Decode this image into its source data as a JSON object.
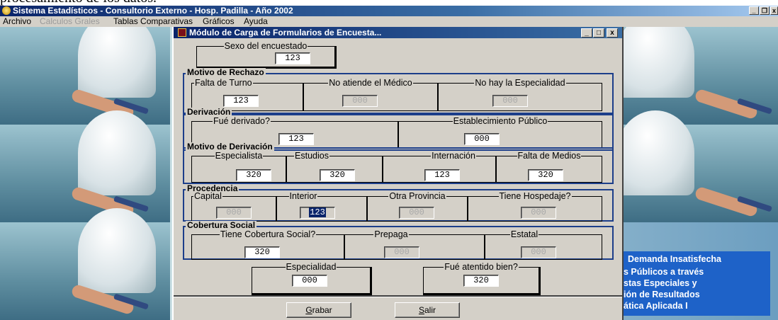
{
  "overtext": "procesamiento de los datos.",
  "app": {
    "title": "Sistema Estadísticos - Consultorio Externo - Hosp. Padilla - Año 2002",
    "win_buttons": [
      "_",
      "❐",
      "x"
    ]
  },
  "menu": {
    "items": [
      {
        "label": "Archivo",
        "disabled": false
      },
      {
        "label": "Calculos Grales",
        "disabled": true
      },
      {
        "label": "Tablas Comparativas",
        "disabled": false
      },
      {
        "label": "Gráficos",
        "disabled": false
      },
      {
        "label": "Ayuda",
        "disabled": false
      }
    ]
  },
  "dialog": {
    "title": "Módulo de Carga de Formularios de Encuesta...",
    "buttons": [
      "_",
      "□",
      "x"
    ],
    "sexo": {
      "label": "Sexo del encuestado",
      "value": "123"
    },
    "rechazo": {
      "title": "Motivo de Rechazo",
      "falta_turno": {
        "label": "Falta de Turno",
        "value": "123"
      },
      "no_atiende": {
        "label": "No atiende el Médico",
        "value": "000"
      },
      "no_hay_esp": {
        "label": "No hay la Especialidad",
        "value": "000"
      }
    },
    "derivacion": {
      "title": "Derivación",
      "fue_derivado": {
        "label": "Fué derivado?",
        "value": "123"
      },
      "establecimiento": {
        "label": "Establecimiento Público",
        "value": "000"
      }
    },
    "motivo_der": {
      "title": "Motivo de Derivación",
      "especialista": {
        "label": "Especialista",
        "value": "320"
      },
      "estudios": {
        "label": "Estudios",
        "value": "320"
      },
      "internacion": {
        "label": "Internación",
        "value": "123"
      },
      "falta_medios": {
        "label": "Falta de Medios",
        "value": "320"
      }
    },
    "procedencia": {
      "title": "Procedencia",
      "capital": {
        "label": "Capital",
        "value": "000"
      },
      "interior": {
        "label": "Interior",
        "value": "123"
      },
      "otra_prov": {
        "label": "Otra Provincia",
        "value": "000"
      },
      "hospedaje": {
        "label": "Tiene Hospedaje?",
        "value": "000"
      }
    },
    "cobertura": {
      "title": "Cobertura Social",
      "tiene": {
        "label": "Tiene Cobertura Social?",
        "value": "320"
      },
      "prepaga": {
        "label": "Prepaga",
        "value": "000"
      },
      "estatal": {
        "label": "Estatal",
        "value": "000"
      }
    },
    "especialidad": {
      "label": "Especialidad",
      "value": "000"
    },
    "atendido": {
      "label": "Fué atentido bien?",
      "value": "320"
    },
    "grabar": {
      "first": "G",
      "rest": "rabar"
    },
    "salir": {
      "first": "S",
      "rest": "alir"
    }
  },
  "side_panel": {
    "lines": [
      "Demanda Insatisfecha",
      "s Públicos a través",
      "stas Especiales y",
      "ión de Resultados",
      "ática Aplicada I"
    ]
  }
}
